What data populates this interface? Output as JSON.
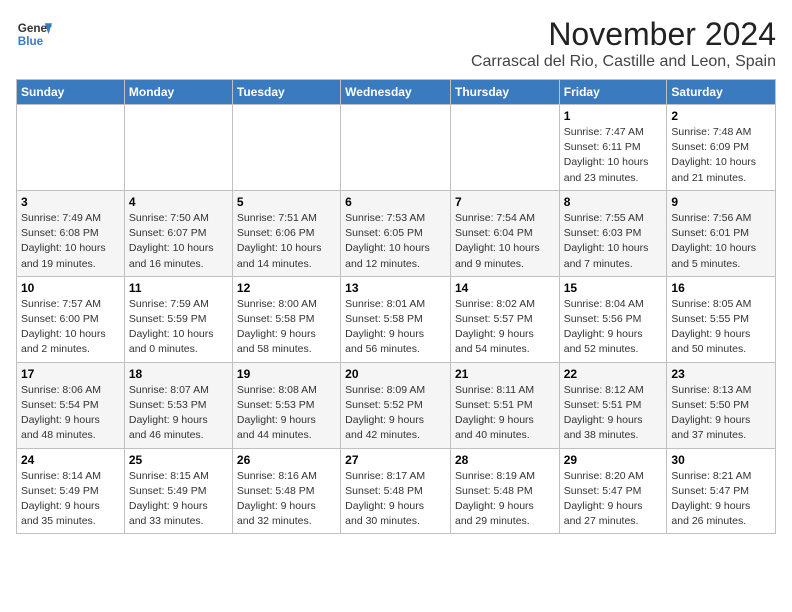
{
  "header": {
    "logo_line1": "General",
    "logo_line2": "Blue",
    "month": "November 2024",
    "location": "Carrascal del Rio, Castille and Leon, Spain"
  },
  "weekdays": [
    "Sunday",
    "Monday",
    "Tuesday",
    "Wednesday",
    "Thursday",
    "Friday",
    "Saturday"
  ],
  "weeks": [
    [
      {
        "day": "",
        "info": ""
      },
      {
        "day": "",
        "info": ""
      },
      {
        "day": "",
        "info": ""
      },
      {
        "day": "",
        "info": ""
      },
      {
        "day": "",
        "info": ""
      },
      {
        "day": "1",
        "info": "Sunrise: 7:47 AM\nSunset: 6:11 PM\nDaylight: 10 hours\nand 23 minutes."
      },
      {
        "day": "2",
        "info": "Sunrise: 7:48 AM\nSunset: 6:09 PM\nDaylight: 10 hours\nand 21 minutes."
      }
    ],
    [
      {
        "day": "3",
        "info": "Sunrise: 7:49 AM\nSunset: 6:08 PM\nDaylight: 10 hours\nand 19 minutes."
      },
      {
        "day": "4",
        "info": "Sunrise: 7:50 AM\nSunset: 6:07 PM\nDaylight: 10 hours\nand 16 minutes."
      },
      {
        "day": "5",
        "info": "Sunrise: 7:51 AM\nSunset: 6:06 PM\nDaylight: 10 hours\nand 14 minutes."
      },
      {
        "day": "6",
        "info": "Sunrise: 7:53 AM\nSunset: 6:05 PM\nDaylight: 10 hours\nand 12 minutes."
      },
      {
        "day": "7",
        "info": "Sunrise: 7:54 AM\nSunset: 6:04 PM\nDaylight: 10 hours\nand 9 minutes."
      },
      {
        "day": "8",
        "info": "Sunrise: 7:55 AM\nSunset: 6:03 PM\nDaylight: 10 hours\nand 7 minutes."
      },
      {
        "day": "9",
        "info": "Sunrise: 7:56 AM\nSunset: 6:01 PM\nDaylight: 10 hours\nand 5 minutes."
      }
    ],
    [
      {
        "day": "10",
        "info": "Sunrise: 7:57 AM\nSunset: 6:00 PM\nDaylight: 10 hours\nand 2 minutes."
      },
      {
        "day": "11",
        "info": "Sunrise: 7:59 AM\nSunset: 5:59 PM\nDaylight: 10 hours\nand 0 minutes."
      },
      {
        "day": "12",
        "info": "Sunrise: 8:00 AM\nSunset: 5:58 PM\nDaylight: 9 hours\nand 58 minutes."
      },
      {
        "day": "13",
        "info": "Sunrise: 8:01 AM\nSunset: 5:58 PM\nDaylight: 9 hours\nand 56 minutes."
      },
      {
        "day": "14",
        "info": "Sunrise: 8:02 AM\nSunset: 5:57 PM\nDaylight: 9 hours\nand 54 minutes."
      },
      {
        "day": "15",
        "info": "Sunrise: 8:04 AM\nSunset: 5:56 PM\nDaylight: 9 hours\nand 52 minutes."
      },
      {
        "day": "16",
        "info": "Sunrise: 8:05 AM\nSunset: 5:55 PM\nDaylight: 9 hours\nand 50 minutes."
      }
    ],
    [
      {
        "day": "17",
        "info": "Sunrise: 8:06 AM\nSunset: 5:54 PM\nDaylight: 9 hours\nand 48 minutes."
      },
      {
        "day": "18",
        "info": "Sunrise: 8:07 AM\nSunset: 5:53 PM\nDaylight: 9 hours\nand 46 minutes."
      },
      {
        "day": "19",
        "info": "Sunrise: 8:08 AM\nSunset: 5:53 PM\nDaylight: 9 hours\nand 44 minutes."
      },
      {
        "day": "20",
        "info": "Sunrise: 8:09 AM\nSunset: 5:52 PM\nDaylight: 9 hours\nand 42 minutes."
      },
      {
        "day": "21",
        "info": "Sunrise: 8:11 AM\nSunset: 5:51 PM\nDaylight: 9 hours\nand 40 minutes."
      },
      {
        "day": "22",
        "info": "Sunrise: 8:12 AM\nSunset: 5:51 PM\nDaylight: 9 hours\nand 38 minutes."
      },
      {
        "day": "23",
        "info": "Sunrise: 8:13 AM\nSunset: 5:50 PM\nDaylight: 9 hours\nand 37 minutes."
      }
    ],
    [
      {
        "day": "24",
        "info": "Sunrise: 8:14 AM\nSunset: 5:49 PM\nDaylight: 9 hours\nand 35 minutes."
      },
      {
        "day": "25",
        "info": "Sunrise: 8:15 AM\nSunset: 5:49 PM\nDaylight: 9 hours\nand 33 minutes."
      },
      {
        "day": "26",
        "info": "Sunrise: 8:16 AM\nSunset: 5:48 PM\nDaylight: 9 hours\nand 32 minutes."
      },
      {
        "day": "27",
        "info": "Sunrise: 8:17 AM\nSunset: 5:48 PM\nDaylight: 9 hours\nand 30 minutes."
      },
      {
        "day": "28",
        "info": "Sunrise: 8:19 AM\nSunset: 5:48 PM\nDaylight: 9 hours\nand 29 minutes."
      },
      {
        "day": "29",
        "info": "Sunrise: 8:20 AM\nSunset: 5:47 PM\nDaylight: 9 hours\nand 27 minutes."
      },
      {
        "day": "30",
        "info": "Sunrise: 8:21 AM\nSunset: 5:47 PM\nDaylight: 9 hours\nand 26 minutes."
      }
    ]
  ]
}
